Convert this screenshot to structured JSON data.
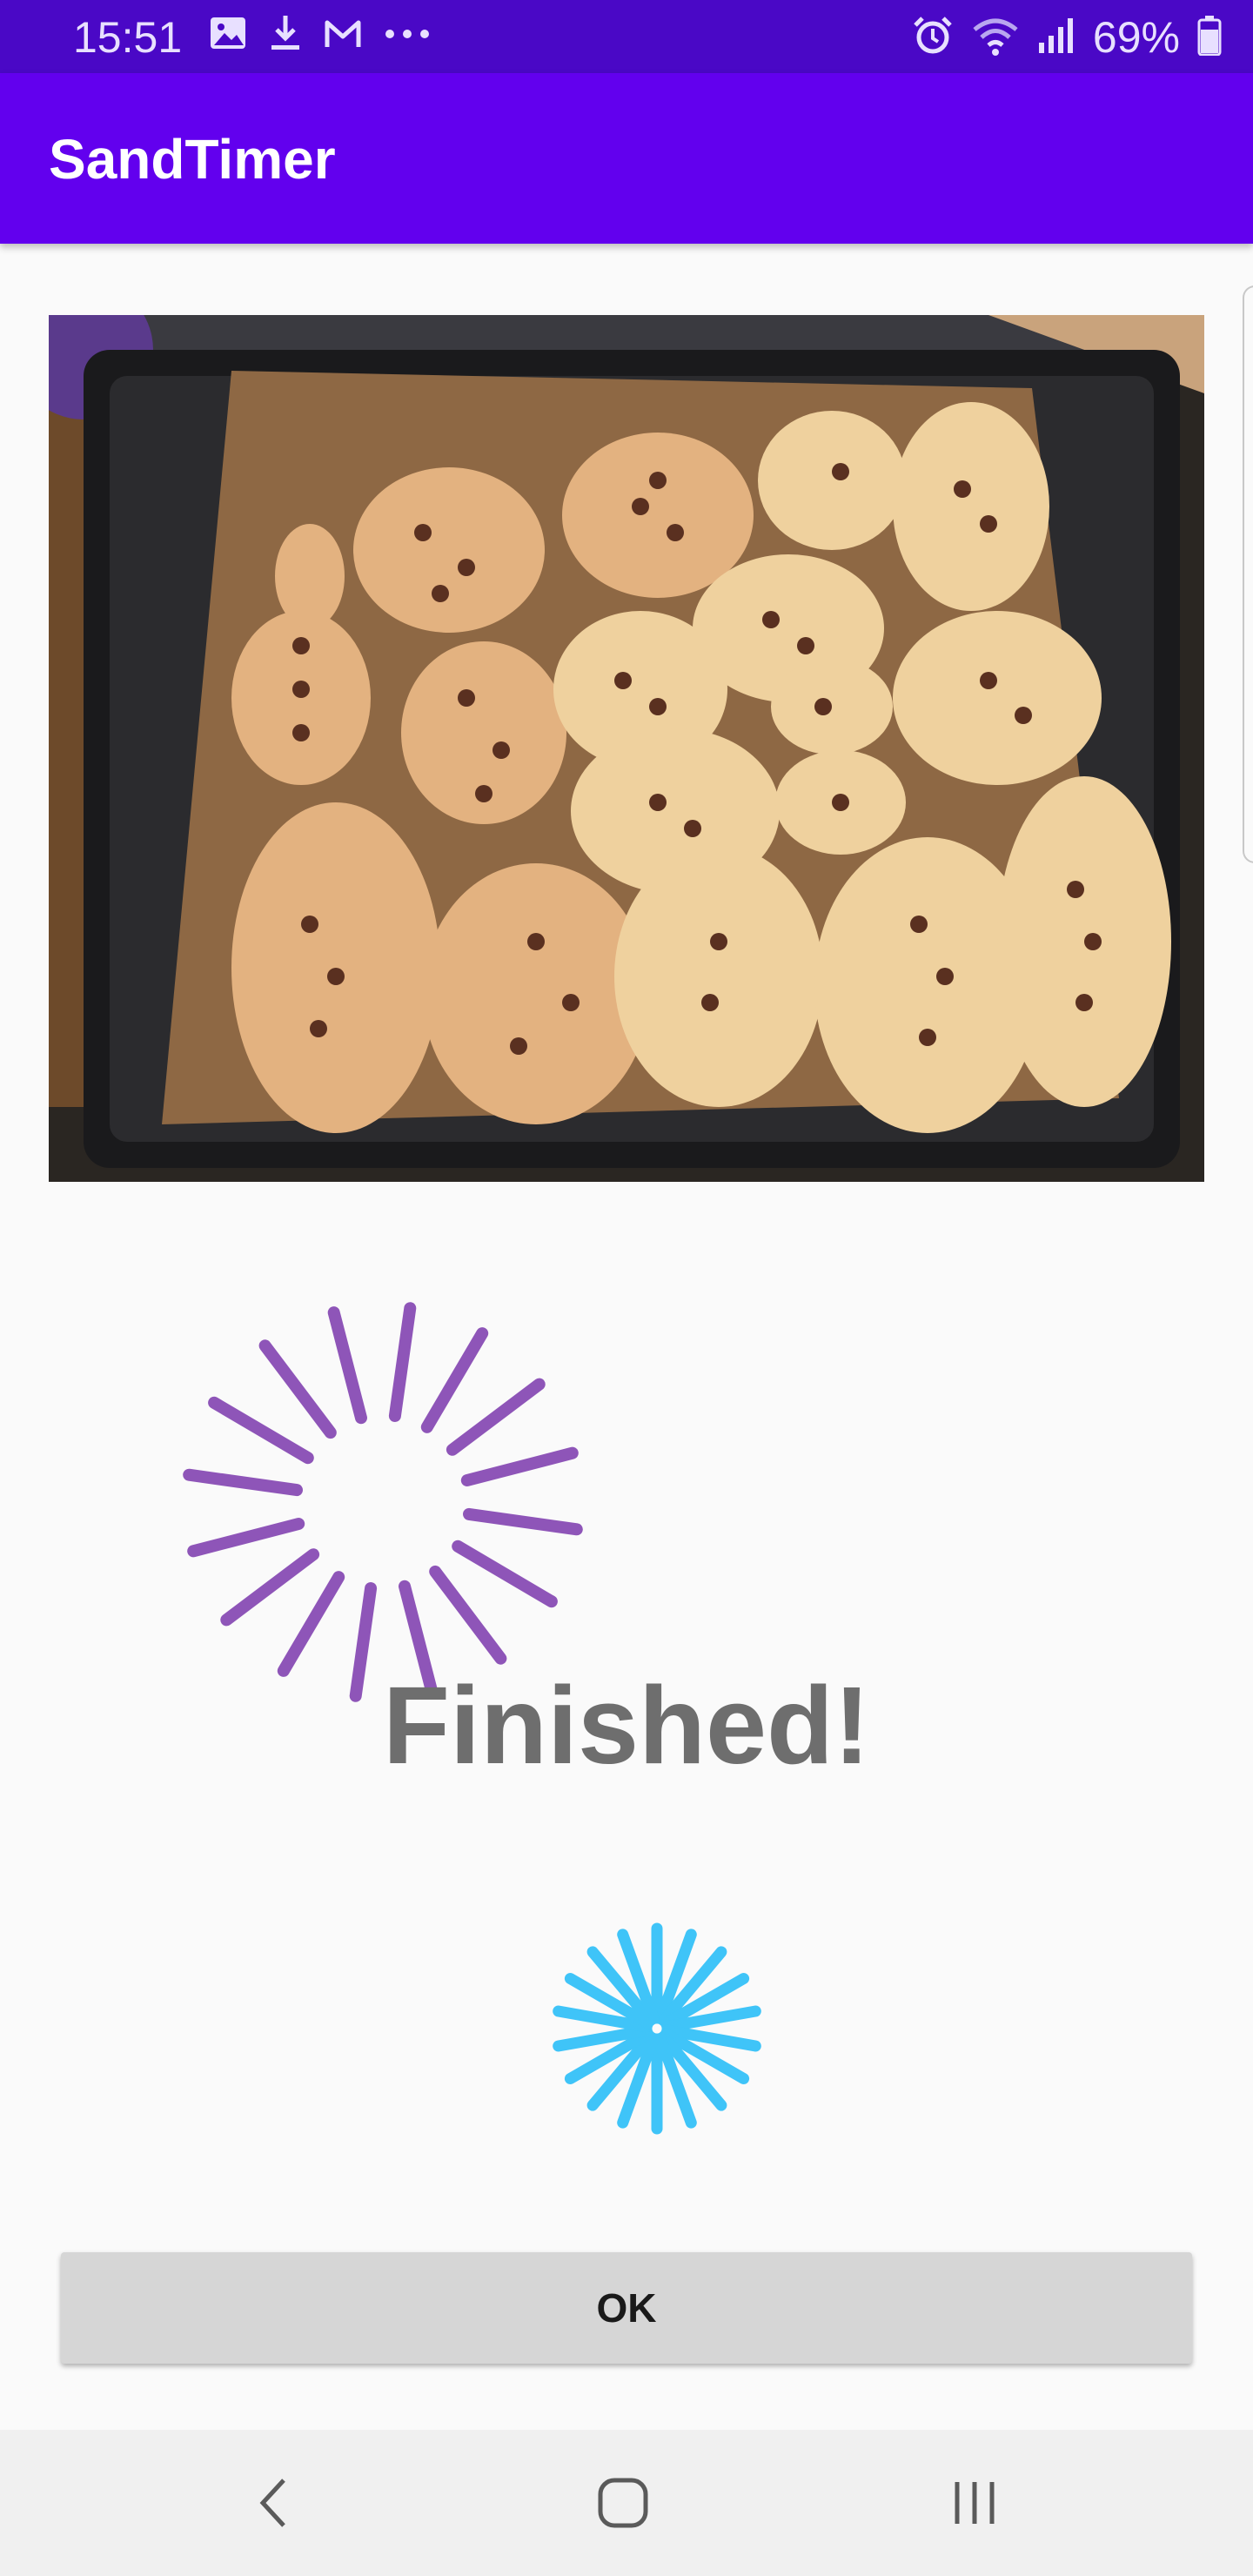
{
  "status_bar": {
    "time": "15:51",
    "battery_percent": "69%",
    "left_icons": [
      "image-icon",
      "download-icon",
      "gmail-icon",
      "more-dots-icon"
    ],
    "right_icons": [
      "alarm-icon",
      "wifi-icon",
      "signal-icon",
      "battery-icon"
    ],
    "battery_level": 0.69
  },
  "app_bar": {
    "title": "SandTimer"
  },
  "colors": {
    "status_bar": "#4a08c6",
    "app_bar": "#6200ee",
    "spinner_purple": "#8e55b8",
    "spinner_blue": "#3fc4f8",
    "finished_text": "#6e6e6e",
    "button_bg": "#d6d6d6"
  },
  "main": {
    "photo_subject": "tray of chocolate chip cookies",
    "finished_text": "Finished!",
    "ok_label": "OK"
  },
  "nav_bar": {
    "icons": [
      "back-icon",
      "home-icon",
      "recents-icon"
    ]
  }
}
